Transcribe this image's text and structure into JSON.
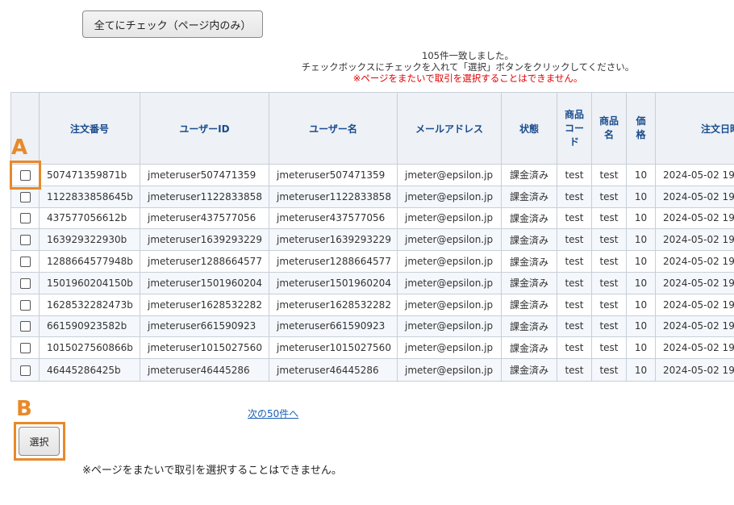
{
  "toolbar": {
    "check_all_label": "全てにチェック（ページ内のみ）"
  },
  "info": {
    "count_text": "105件一致しました。",
    "instruction": "チェックボックスにチェックを入れて「選択」ボタンをクリックしてください。",
    "warning": "※ページをまたいで取引を選択することはできません。"
  },
  "table": {
    "headers": [
      "注文番号",
      "ユーザーID",
      "ユーザー名",
      "メールアドレス",
      "状態",
      "商品コード",
      "商品名",
      "価格",
      "注文日時"
    ],
    "rows": [
      {
        "order_no": "507471359871b",
        "user_id": "jmeteruser507471359",
        "user_name": "jmeteruser507471359",
        "email": "jmeter@epsilon.jp",
        "status": "課金済み",
        "product_code": "test",
        "product_name": "test",
        "price": "10",
        "ordered_at": "2024-05-02 19"
      },
      {
        "order_no": "1122833858645b",
        "user_id": "jmeteruser1122833858",
        "user_name": "jmeteruser1122833858",
        "email": "jmeter@epsilon.jp",
        "status": "課金済み",
        "product_code": "test",
        "product_name": "test",
        "price": "10",
        "ordered_at": "2024-05-02 19"
      },
      {
        "order_no": "437577056612b",
        "user_id": "jmeteruser437577056",
        "user_name": "jmeteruser437577056",
        "email": "jmeter@epsilon.jp",
        "status": "課金済み",
        "product_code": "test",
        "product_name": "test",
        "price": "10",
        "ordered_at": "2024-05-02 19"
      },
      {
        "order_no": "163929322930b",
        "user_id": "jmeteruser1639293229",
        "user_name": "jmeteruser1639293229",
        "email": "jmeter@epsilon.jp",
        "status": "課金済み",
        "product_code": "test",
        "product_name": "test",
        "price": "10",
        "ordered_at": "2024-05-02 19"
      },
      {
        "order_no": "1288664577948b",
        "user_id": "jmeteruser1288664577",
        "user_name": "jmeteruser1288664577",
        "email": "jmeter@epsilon.jp",
        "status": "課金済み",
        "product_code": "test",
        "product_name": "test",
        "price": "10",
        "ordered_at": "2024-05-02 19"
      },
      {
        "order_no": "1501960204150b",
        "user_id": "jmeteruser1501960204",
        "user_name": "jmeteruser1501960204",
        "email": "jmeter@epsilon.jp",
        "status": "課金済み",
        "product_code": "test",
        "product_name": "test",
        "price": "10",
        "ordered_at": "2024-05-02 19"
      },
      {
        "order_no": "1628532282473b",
        "user_id": "jmeteruser1628532282",
        "user_name": "jmeteruser1628532282",
        "email": "jmeter@epsilon.jp",
        "status": "課金済み",
        "product_code": "test",
        "product_name": "test",
        "price": "10",
        "ordered_at": "2024-05-02 19"
      },
      {
        "order_no": "661590923582b",
        "user_id": "jmeteruser661590923",
        "user_name": "jmeteruser661590923",
        "email": "jmeter@epsilon.jp",
        "status": "課金済み",
        "product_code": "test",
        "product_name": "test",
        "price": "10",
        "ordered_at": "2024-05-02 19"
      },
      {
        "order_no": "1015027560866b",
        "user_id": "jmeteruser1015027560",
        "user_name": "jmeteruser1015027560",
        "email": "jmeter@epsilon.jp",
        "status": "課金済み",
        "product_code": "test",
        "product_name": "test",
        "price": "10",
        "ordered_at": "2024-05-02 19"
      },
      {
        "order_no": "46445286425b",
        "user_id": "jmeteruser46445286",
        "user_name": "jmeteruser46445286",
        "email": "jmeter@epsilon.jp",
        "status": "課金済み",
        "product_code": "test",
        "product_name": "test",
        "price": "10",
        "ordered_at": "2024-05-02 19"
      }
    ]
  },
  "annotations": {
    "a_label": "A",
    "b_label": "B",
    "color": "#e8892a"
  },
  "pagination": {
    "next_label": "次の50件へ"
  },
  "actions": {
    "select_label": "選択"
  },
  "footer": {
    "note": "※ページをまたいで取引を選択することはできません。"
  }
}
